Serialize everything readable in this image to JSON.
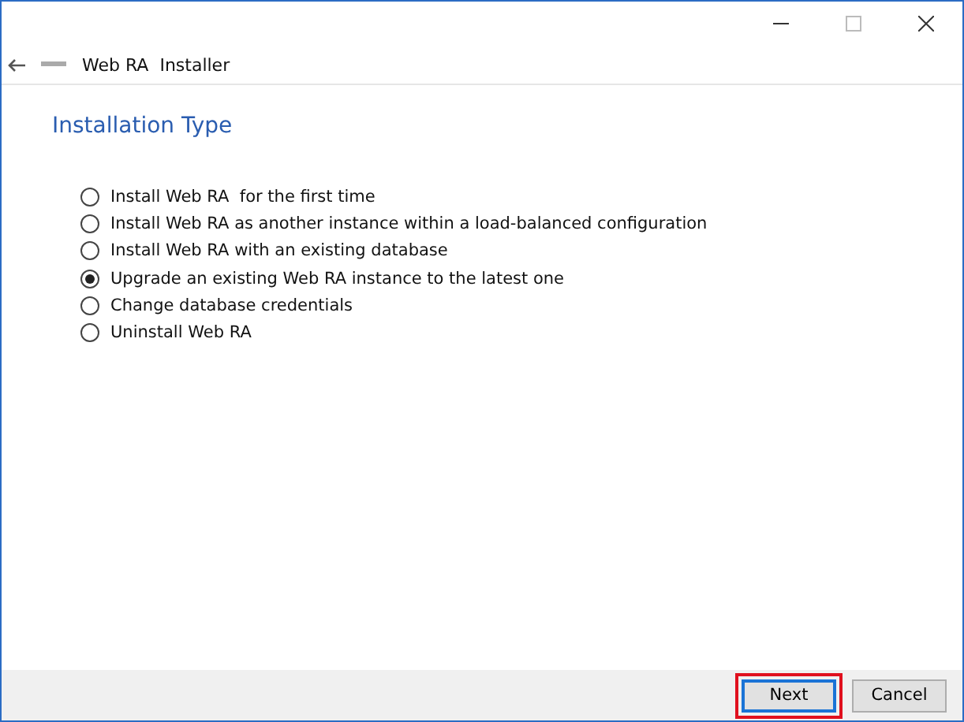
{
  "window": {
    "title": "Web RA  Installer"
  },
  "heading": "Installation Type",
  "options": [
    {
      "label": "Install Web RA  for the first time",
      "selected": false
    },
    {
      "label": "Install Web RA as another instance within a load-balanced configuration",
      "selected": false
    },
    {
      "label": "Install Web RA with an existing database",
      "selected": false
    },
    {
      "label": "Upgrade an existing Web RA instance to the latest one",
      "selected": true
    },
    {
      "label": "Change database credentials",
      "selected": false
    },
    {
      "label": "Uninstall Web RA",
      "selected": false
    }
  ],
  "buttons": [
    {
      "label": "Next",
      "highlighted": true,
      "default": true
    },
    {
      "label": "Cancel",
      "highlighted": false,
      "default": false
    }
  ]
}
